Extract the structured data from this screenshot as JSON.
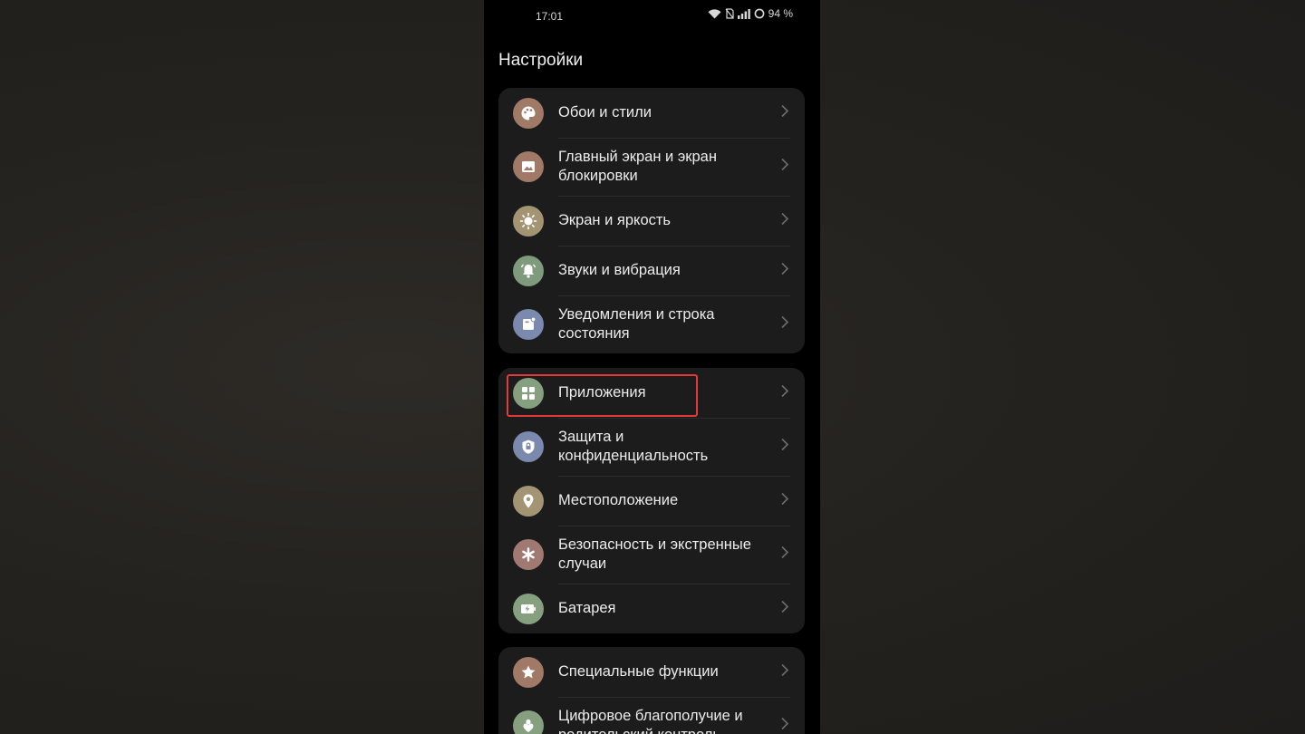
{
  "status_bar": {
    "time": "17:01",
    "battery_percent": "94 %",
    "icons": [
      "wifi-icon",
      "no-sim-icon",
      "signal-icon",
      "battery-ring-icon"
    ]
  },
  "page_title": "Настройки",
  "groups": [
    {
      "items": [
        {
          "label": "Обои и стили",
          "icon": "palette-icon",
          "color": "#a07a66"
        },
        {
          "label": "Главный экран и экран блокировки",
          "icon": "image-icon",
          "color": "#a07a66"
        },
        {
          "label": "Экран и яркость",
          "icon": "sun-icon",
          "color": "#a39574"
        },
        {
          "label": "Звуки и вибрация",
          "icon": "bell-icon",
          "color": "#7f9a7c"
        },
        {
          "label": "Уведомления и строка состояния",
          "icon": "notification-icon",
          "color": "#7a89ad"
        }
      ]
    },
    {
      "items": [
        {
          "label": "Приложения",
          "icon": "apps-grid-icon",
          "color": "#86a07f",
          "highlighted": true
        },
        {
          "label": "Защита и конфиденциальность",
          "icon": "shield-icon",
          "color": "#7a89ad"
        },
        {
          "label": "Местоположение",
          "icon": "location-pin-icon",
          "color": "#a39574"
        },
        {
          "label": "Безопасность и экстренные случаи",
          "icon": "asterisk-icon",
          "color": "#a07a72"
        },
        {
          "label": "Батарея",
          "icon": "battery-icon",
          "color": "#86a07f"
        }
      ]
    },
    {
      "items": [
        {
          "label": "Специальные функции",
          "icon": "star-icon",
          "color": "#a07a66"
        },
        {
          "label": "Цифровое благополучие и родительский контроль",
          "icon": "heart-person-icon",
          "color": "#86a07f"
        }
      ]
    }
  ],
  "colors": {
    "highlight": "#e23a3a",
    "card": "#1c1c1c",
    "background": "#000000"
  }
}
